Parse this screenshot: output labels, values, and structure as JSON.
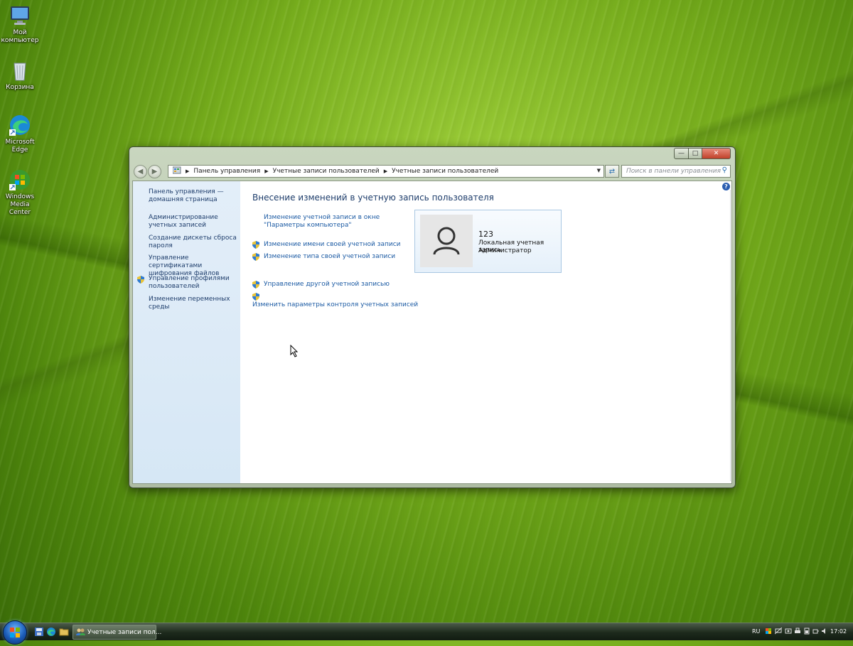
{
  "desktop": {
    "icons": [
      {
        "label": "Мой компьютер"
      },
      {
        "label": "Корзина"
      },
      {
        "label": "Microsoft Edge"
      },
      {
        "label": "Windows Media Center"
      }
    ]
  },
  "window": {
    "breadcrumb": [
      "Панель управления",
      "Учетные записи пользователей",
      "Учетные записи пользователей"
    ],
    "search_placeholder": "Поиск в панели управления",
    "sidebar": {
      "items": [
        {
          "label": "Панель управления — домашняя страница"
        },
        {
          "label": "Администрирование учетных записей"
        },
        {
          "label": "Создание дискеты сброса пароля"
        },
        {
          "label": "Управление сертификатами шифрования файлов"
        },
        {
          "label": "Управление профилями пользователей"
        },
        {
          "label": "Изменение переменных среды"
        }
      ]
    },
    "main": {
      "heading": "Внесение изменений в учетную запись пользователя",
      "links": [
        "Изменение учетной записи в окне \"Параметры компьютера\"",
        "Изменение имени своей учетной записи",
        "Изменение типа своей учетной записи",
        "Управление другой учетной записью",
        "Изменить параметры контроля учетных записей"
      ]
    },
    "user": {
      "name": "123",
      "type": "Локальная учетная запись",
      "role": "Администратор"
    }
  },
  "taskbar": {
    "task_label": "Учетные записи пол...",
    "language": "RU",
    "clock": "17:02"
  }
}
